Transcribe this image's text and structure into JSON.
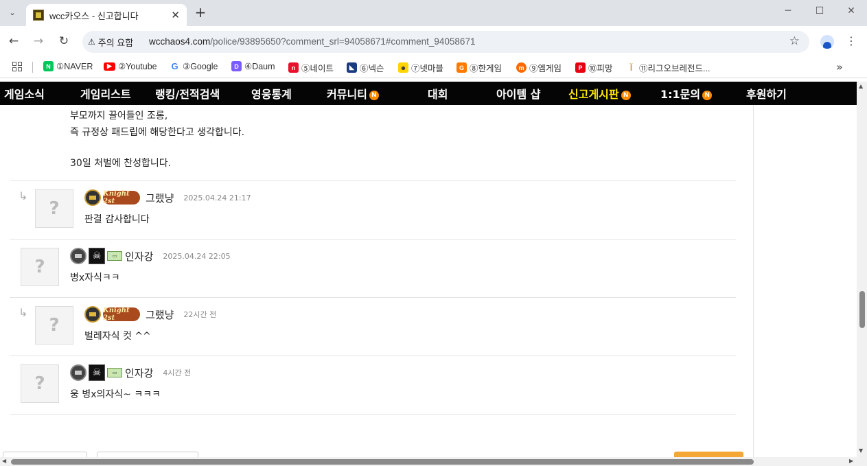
{
  "browser": {
    "tab_title": "wcc카오스 - 신고합니다",
    "close_glyph": "✕",
    "new_tab_glyph": "+",
    "dropdown_glyph": "⌄",
    "security_label": "주의 요함",
    "url_host": "wcchaos4.com",
    "url_path": "/police/93895650?comment_srl=94058671#comment_94058671",
    "bookmarks": [
      "①NAVER",
      "②Youtube",
      "③Google",
      "④Daum",
      "⑤네이트",
      "⑥넥슨",
      "⑦넷마블",
      "⑧한게임",
      "⑨엠게임",
      "⑩피망",
      "⑪리그오브레전드..."
    ],
    "more_glyph": "»"
  },
  "nav": {
    "items": [
      "게임소식",
      "게임리스트",
      "랭킹/전적검색",
      "영웅통계",
      "커뮤니티",
      "대회",
      "아이템 샵",
      "신고게시판",
      "1:1문의",
      "후원하기"
    ],
    "badge": "N"
  },
  "post_tail": {
    "line1": "부모까지 끌어들인 조롱,",
    "line2": "즉 규정상 패드립에 해당한다고 생각합니다.",
    "line3": "30일 처벌에 찬성합니다."
  },
  "comments": [
    {
      "reply": true,
      "nick": "그랬냥",
      "date": "2025.04.24 21:17",
      "body": "판결 감사합니다",
      "knight": "Knight 2st"
    },
    {
      "reply": false,
      "nick": "인자강",
      "date": "2025.04.24 22:05",
      "body": "병x자식ㅋㅋ"
    },
    {
      "reply": true,
      "nick": "그랬냥",
      "date": "22시간 전",
      "body": "벌레자식 컷 ^^",
      "knight": "Knight 2st"
    },
    {
      "reply": false,
      "nick": "인자강",
      "date": "4시간 전",
      "body": "웅 병x의자식~ ㅋㅋㅋ"
    }
  ],
  "avatar_placeholder": "?",
  "reply_glyph": "↳",
  "skull_glyph": "☠"
}
